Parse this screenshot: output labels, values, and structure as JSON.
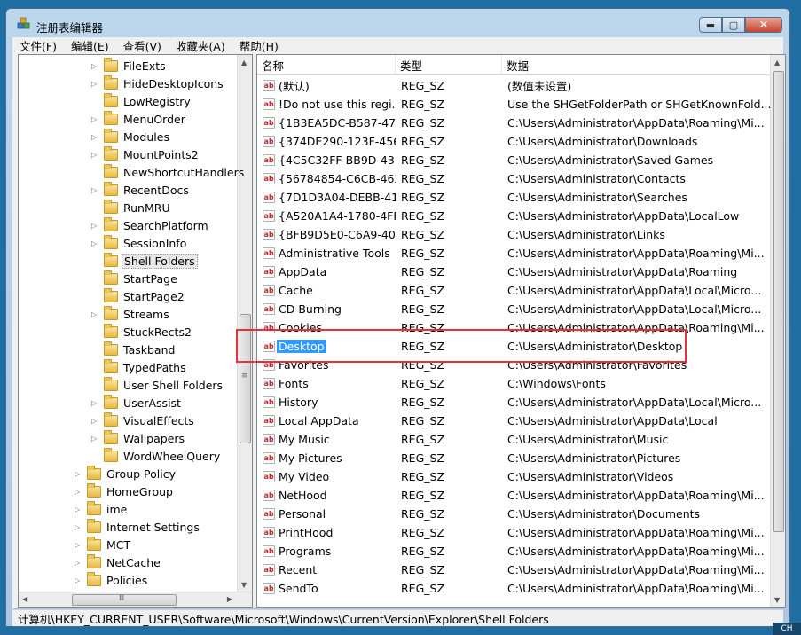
{
  "window": {
    "title": "注册表编辑器"
  },
  "menu": [
    "文件(F)",
    "编辑(E)",
    "查看(V)",
    "收藏夹(A)",
    "帮助(H)"
  ],
  "window_buttons": {
    "minimize": "▬",
    "maximize": "▢",
    "close": "✕"
  },
  "tree": {
    "items": [
      {
        "label": "FileExts",
        "level": 2,
        "expandable": true
      },
      {
        "label": "HideDesktopIcons",
        "level": 2,
        "expandable": true
      },
      {
        "label": "LowRegistry",
        "level": 2,
        "expandable": false
      },
      {
        "label": "MenuOrder",
        "level": 2,
        "expandable": true
      },
      {
        "label": "Modules",
        "level": 2,
        "expandable": true
      },
      {
        "label": "MountPoints2",
        "level": 2,
        "expandable": true
      },
      {
        "label": "NewShortcutHandlers",
        "level": 2,
        "expandable": false
      },
      {
        "label": "RecentDocs",
        "level": 2,
        "expandable": true
      },
      {
        "label": "RunMRU",
        "level": 2,
        "expandable": false
      },
      {
        "label": "SearchPlatform",
        "level": 2,
        "expandable": true
      },
      {
        "label": "SessionInfo",
        "level": 2,
        "expandable": true
      },
      {
        "label": "Shell Folders",
        "level": 2,
        "expandable": false,
        "selected": true
      },
      {
        "label": "StartPage",
        "level": 2,
        "expandable": false
      },
      {
        "label": "StartPage2",
        "level": 2,
        "expandable": false
      },
      {
        "label": "Streams",
        "level": 2,
        "expandable": true
      },
      {
        "label": "StuckRects2",
        "level": 2,
        "expandable": false
      },
      {
        "label": "Taskband",
        "level": 2,
        "expandable": false
      },
      {
        "label": "TypedPaths",
        "level": 2,
        "expandable": false
      },
      {
        "label": "User Shell Folders",
        "level": 2,
        "expandable": false
      },
      {
        "label": "UserAssist",
        "level": 2,
        "expandable": true
      },
      {
        "label": "VisualEffects",
        "level": 2,
        "expandable": true
      },
      {
        "label": "Wallpapers",
        "level": 2,
        "expandable": true
      },
      {
        "label": "WordWheelQuery",
        "level": 2,
        "expandable": false
      },
      {
        "label": "Group Policy",
        "level": 1,
        "expandable": true
      },
      {
        "label": "HomeGroup",
        "level": 1,
        "expandable": true
      },
      {
        "label": "ime",
        "level": 1,
        "expandable": true
      },
      {
        "label": "Internet Settings",
        "level": 1,
        "expandable": true
      },
      {
        "label": "MCT",
        "level": 1,
        "expandable": true
      },
      {
        "label": "NetCache",
        "level": 1,
        "expandable": true
      },
      {
        "label": "Policies",
        "level": 1,
        "expandable": true
      }
    ],
    "hscroll_grip": "Ⅲ",
    "vscroll_grip": "≡"
  },
  "list": {
    "columns": [
      "名称",
      "类型",
      "数据"
    ],
    "rows": [
      {
        "name": "(默认)",
        "type": "REG_SZ",
        "data": "(数值未设置)"
      },
      {
        "name": "!Do not use this regi...",
        "type": "REG_SZ",
        "data": "Use the SHGetFolderPath or SHGetKnownFold..."
      },
      {
        "name": "{1B3EA5DC-B587-47...",
        "type": "REG_SZ",
        "data": "C:\\Users\\Administrator\\AppData\\Roaming\\Mi..."
      },
      {
        "name": "{374DE290-123F-456...",
        "type": "REG_SZ",
        "data": "C:\\Users\\Administrator\\Downloads"
      },
      {
        "name": "{4C5C32FF-BB9D-43...",
        "type": "REG_SZ",
        "data": "C:\\Users\\Administrator\\Saved Games"
      },
      {
        "name": "{56784854-C6CB-462...",
        "type": "REG_SZ",
        "data": "C:\\Users\\Administrator\\Contacts"
      },
      {
        "name": "{7D1D3A04-DEBB-41...",
        "type": "REG_SZ",
        "data": "C:\\Users\\Administrator\\Searches"
      },
      {
        "name": "{A520A1A4-1780-4FF...",
        "type": "REG_SZ",
        "data": "C:\\Users\\Administrator\\AppData\\LocalLow"
      },
      {
        "name": "{BFB9D5E0-C6A9-40...",
        "type": "REG_SZ",
        "data": "C:\\Users\\Administrator\\Links"
      },
      {
        "name": "Administrative Tools",
        "type": "REG_SZ",
        "data": "C:\\Users\\Administrator\\AppData\\Roaming\\Mi..."
      },
      {
        "name": "AppData",
        "type": "REG_SZ",
        "data": "C:\\Users\\Administrator\\AppData\\Roaming"
      },
      {
        "name": "Cache",
        "type": "REG_SZ",
        "data": "C:\\Users\\Administrator\\AppData\\Local\\Micro..."
      },
      {
        "name": "CD Burning",
        "type": "REG_SZ",
        "data": "C:\\Users\\Administrator\\AppData\\Local\\Micro..."
      },
      {
        "name": "Cookies",
        "type": "REG_SZ",
        "data": "C:\\Users\\Administrator\\AppData\\Roaming\\Mi..."
      },
      {
        "name": "Desktop",
        "type": "REG_SZ",
        "data": "C:\\Users\\Administrator\\Desktop",
        "selected": true
      },
      {
        "name": "Favorites",
        "type": "REG_SZ",
        "data": "C:\\Users\\Administrator\\Favorites"
      },
      {
        "name": "Fonts",
        "type": "REG_SZ",
        "data": "C:\\Windows\\Fonts"
      },
      {
        "name": "History",
        "type": "REG_SZ",
        "data": "C:\\Users\\Administrator\\AppData\\Local\\Micro..."
      },
      {
        "name": "Local AppData",
        "type": "REG_SZ",
        "data": "C:\\Users\\Administrator\\AppData\\Local"
      },
      {
        "name": "My Music",
        "type": "REG_SZ",
        "data": "C:\\Users\\Administrator\\Music"
      },
      {
        "name": "My Pictures",
        "type": "REG_SZ",
        "data": "C:\\Users\\Administrator\\Pictures"
      },
      {
        "name": "My Video",
        "type": "REG_SZ",
        "data": "C:\\Users\\Administrator\\Videos"
      },
      {
        "name": "NetHood",
        "type": "REG_SZ",
        "data": "C:\\Users\\Administrator\\AppData\\Roaming\\Mi..."
      },
      {
        "name": "Personal",
        "type": "REG_SZ",
        "data": "C:\\Users\\Administrator\\Documents"
      },
      {
        "name": "PrintHood",
        "type": "REG_SZ",
        "data": "C:\\Users\\Administrator\\AppData\\Roaming\\Mi..."
      },
      {
        "name": "Programs",
        "type": "REG_SZ",
        "data": "C:\\Users\\Administrator\\AppData\\Roaming\\Mi..."
      },
      {
        "name": "Recent",
        "type": "REG_SZ",
        "data": "C:\\Users\\Administrator\\AppData\\Roaming\\Mi..."
      },
      {
        "name": "SendTo",
        "type": "REG_SZ",
        "data": "C:\\Users\\Administrator\\AppData\\Roaming\\Mi..."
      }
    ],
    "value_icon": "ab"
  },
  "statusbar": {
    "path": "计算机\\HKEY_CURRENT_USER\\Software\\Microsoft\\Windows\\CurrentVersion\\Explorer\\Shell Folders"
  },
  "tray": {
    "lang": "CH"
  },
  "colors": {
    "selection": "#3399ff",
    "annotation": "#e0333b"
  }
}
